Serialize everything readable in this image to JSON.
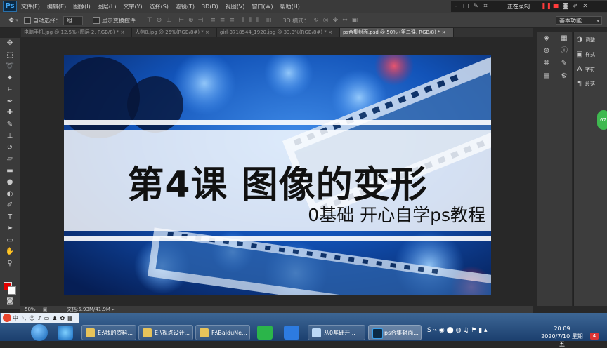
{
  "app": {
    "logo": "Ps"
  },
  "menu": [
    "文件(F)",
    "编辑(E)",
    "图像(I)",
    "图层(L)",
    "文字(Y)",
    "选择(S)",
    "滤镜(T)",
    "3D(D)",
    "视图(V)",
    "窗口(W)",
    "帮助(H)"
  ],
  "recorder": {
    "status": "正在录制"
  },
  "options": {
    "auto_select_label": "自动选择：",
    "auto_select_value": "组",
    "show_transform_label": "显示变换控件",
    "mode_3d_label": "3D 模式："
  },
  "workspace": {
    "value": "基本功能"
  },
  "tabs": [
    {
      "label": "电脑手机.jpg @ 12.5% (图层 2, RGB/8) *",
      "active": false
    },
    {
      "label": "人物0.jpg @ 25%(RGB/8#) *",
      "active": false
    },
    {
      "label": "girl-3718544_1920.jpg @ 33.3%(RGB/8#) *",
      "active": false
    },
    {
      "label": "ps合集封面.psd @ 50% (第二课, RGB/8) *",
      "active": true
    }
  ],
  "artwork": {
    "title": "第4课  图像的变形",
    "subtitle": "0基础 开心自学ps教程"
  },
  "status": {
    "zoom": "50%",
    "doc": "文档:5.93M/41.9M"
  },
  "right_panel": {
    "items": [
      {
        "label": "调整",
        "icon": "adjust-icon"
      },
      {
        "label": "样式",
        "icon": "style-icon"
      },
      {
        "label": "字符",
        "icon": "character-icon"
      },
      {
        "label": "段落",
        "icon": "paragraph-icon"
      }
    ]
  },
  "badge": {
    "text": "67"
  },
  "taskbar": {
    "ime": "中",
    "buttons": [
      {
        "label": "E:\\我的资料...",
        "type": "folder"
      },
      {
        "label": "E:\\视点设计...",
        "type": "folder"
      },
      {
        "label": "F:\\BaiduNe...",
        "type": "folder"
      },
      {
        "label": "从0基础开...",
        "type": "app"
      },
      {
        "label": "ps合集封面...",
        "type": "ps"
      }
    ],
    "time": "20:09",
    "date": "2020/7/10 星期五",
    "notification_count": "4"
  },
  "colors": {
    "foreground": "#e30000",
    "background": "#ffffff",
    "accent": "#31a8ff"
  }
}
